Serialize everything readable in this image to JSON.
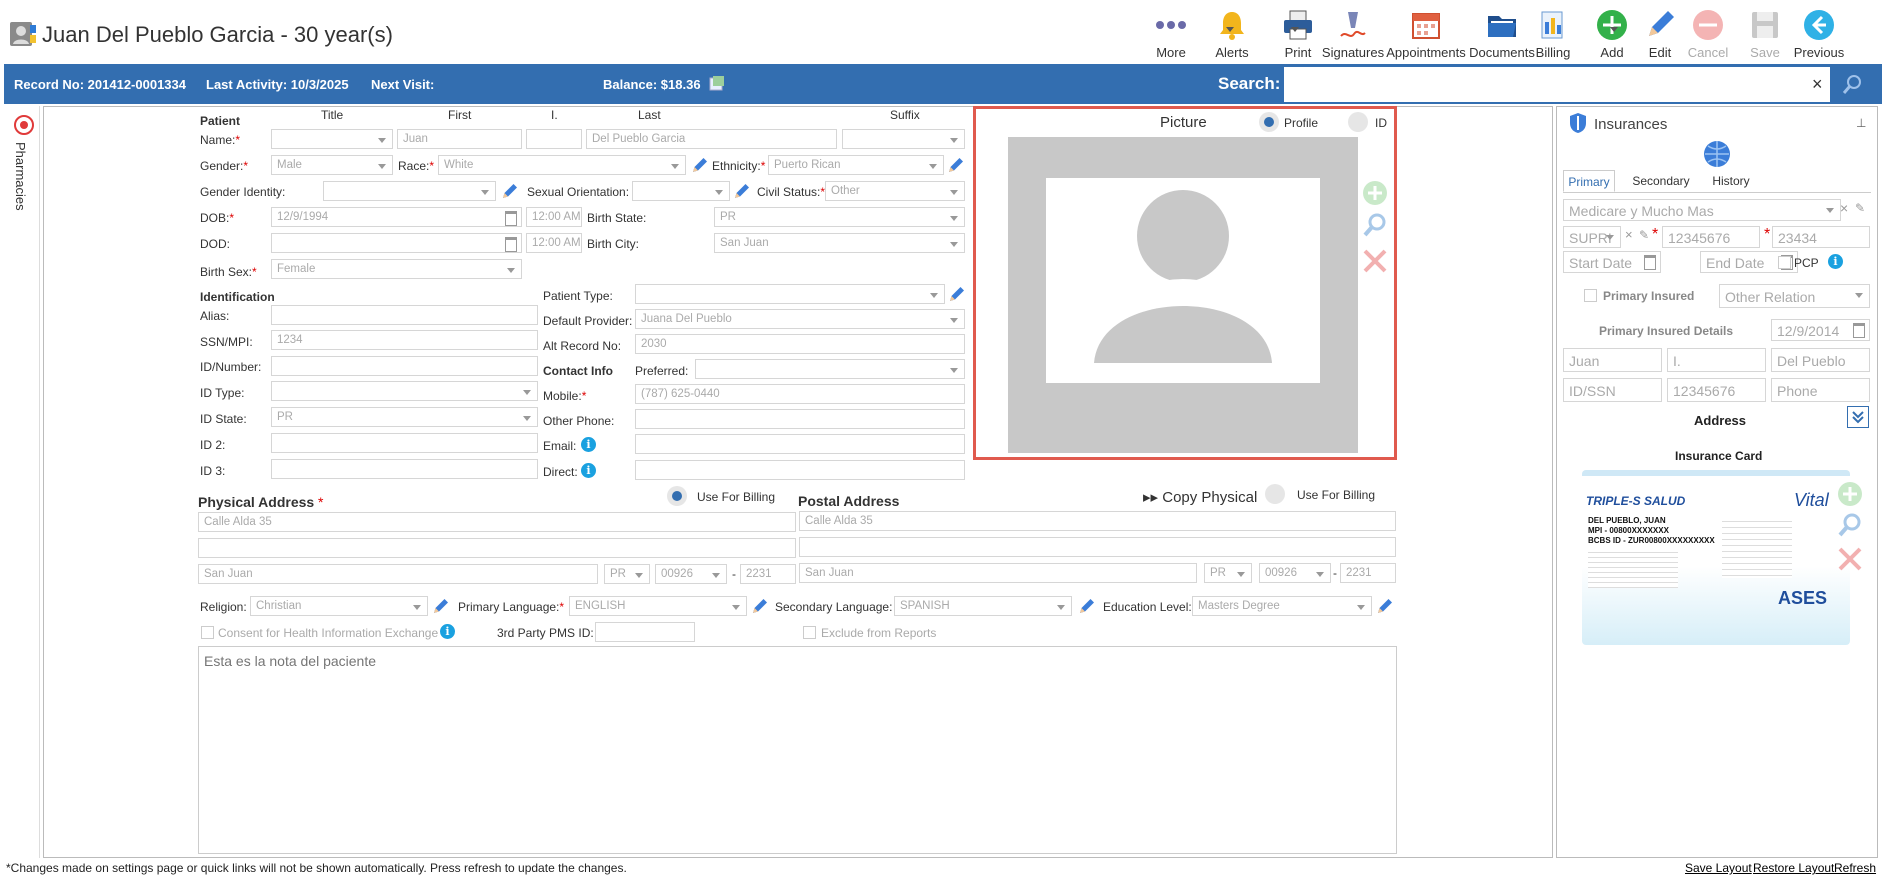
{
  "header": {
    "title": "Juan Del Pueblo Garcia - 30 year(s)",
    "toolbar": [
      {
        "name": "more",
        "label": "More",
        "icon": "more-dots-icon",
        "disabled": false
      },
      {
        "name": "alerts",
        "label": "Alerts",
        "icon": "bell-icon",
        "disabled": false
      },
      {
        "name": "print",
        "label": "Print",
        "icon": "printer-icon",
        "disabled": false
      },
      {
        "name": "signatures",
        "label": "Signatures",
        "icon": "signature-pen-icon",
        "disabled": false
      },
      {
        "name": "appointments",
        "label": "Appointments",
        "icon": "calendar-icon",
        "disabled": false
      },
      {
        "name": "documents",
        "label": "Documents",
        "icon": "folder-icon",
        "disabled": false
      },
      {
        "name": "billing",
        "label": "Billing",
        "icon": "billing-icon",
        "disabled": false
      },
      {
        "name": "add",
        "label": "Add",
        "icon": "plus-circle-icon",
        "disabled": false
      },
      {
        "name": "edit",
        "label": "Edit",
        "icon": "pencil-icon",
        "disabled": false
      },
      {
        "name": "cancel",
        "label": "Cancel",
        "icon": "minus-circle-icon",
        "disabled": true
      },
      {
        "name": "save",
        "label": "Save",
        "icon": "floppy-icon",
        "disabled": true
      },
      {
        "name": "previous",
        "label": "Previous",
        "icon": "back-arrow-icon",
        "disabled": false
      }
    ]
  },
  "infobar": {
    "record": "Record No: 201412-0001334",
    "last_activity": "Last Activity: 10/3/2025",
    "next_visit": "Next Visit:",
    "balance": "Balance: $18.36",
    "search_label": "Search:",
    "search_value": "",
    "clear": "×"
  },
  "sidebar": {
    "pharmacies": "Pharmacies"
  },
  "patient": {
    "section": "Patient",
    "col_title": "Title",
    "col_first": "First",
    "col_i": "I.",
    "col_last": "Last",
    "col_suffix": "Suffix",
    "name_label": "Name:",
    "first": "Juan",
    "middle": "",
    "last": "Del Pueblo Garcia",
    "title": "",
    "suffix": "",
    "gender_label": "Gender:",
    "gender": "Male",
    "race_label": "Race:",
    "race": "White",
    "ethnicity_label": "Ethnicity:",
    "ethnicity": "Puerto Rican",
    "gender_identity_label": "Gender Identity:",
    "gender_identity": "",
    "sexual_orientation_label": "Sexual Orientation:",
    "sexual_orientation": "",
    "civil_status_label": "Civil Status:",
    "civil_status": "Other",
    "dob_label": "DOB:",
    "dob": "12/9/1994",
    "dob_time": "12:00 AM",
    "birth_state_label": "Birth State:",
    "birth_state": "PR",
    "dod_label": "DOD:",
    "dod": "",
    "dod_time": "12:00 AM",
    "birth_city_label": "Birth City:",
    "birth_city": "San Juan",
    "birth_sex_label": "Birth Sex:",
    "birth_sex": "Female",
    "req": "*"
  },
  "identification": {
    "section": "Identification",
    "alias_label": "Alias:",
    "alias": "",
    "ssn_label": "SSN/MPI:",
    "ssn": "1234",
    "idnum_label": "ID/Number:",
    "idnum": "",
    "idtype_label": "ID Type:",
    "idtype": "",
    "idstate_label": "ID State:",
    "idstate": "PR",
    "id2_label": "ID 2:",
    "id2": "",
    "id3_label": "ID 3:",
    "id3": "",
    "patient_type_label": "Patient Type:",
    "patient_type": "",
    "default_provider_label": "Default Provider:",
    "default_provider": "Juana Del Pueblo",
    "alt_record_label": "Alt Record No:",
    "alt_record": "2030"
  },
  "contact": {
    "section": "Contact Info",
    "preferred_label": "Preferred:",
    "preferred": "",
    "mobile_label": "Mobile:",
    "mobile": "(787) 625-0440",
    "other_phone_label": "Other Phone:",
    "other_phone": "",
    "email_label": "Email:",
    "email": "",
    "direct_label": "Direct:",
    "direct": ""
  },
  "picture": {
    "title": "Picture",
    "profile": "Profile",
    "id": "ID"
  },
  "physical": {
    "section": "Physical Address",
    "use_billing": "Use For Billing",
    "line1": "Calle Alda 35",
    "line2": "",
    "city": "San Juan",
    "state": "PR",
    "zip": "00926",
    "zip4": "2231",
    "dash": "-"
  },
  "postal": {
    "section": "Postal Address",
    "copy": "Copy Physical",
    "use_billing": "Use For Billing",
    "line1": "Calle Alda 35",
    "line2": "",
    "city": "San Juan",
    "state": "PR",
    "zip": "00926",
    "zip4": "2231",
    "dash": "-"
  },
  "misc": {
    "religion_label": "Religion:",
    "religion": "Christian",
    "primary_lang_label": "Primary Language:",
    "primary_lang": "ENGLISH",
    "secondary_lang_label": "Secondary Language:",
    "secondary_lang": "SPANISH",
    "education_label": "Education Level:",
    "education": "Masters Degree",
    "consent_label": "Consent for Health Information Exchange",
    "pms_label": "3rd Party PMS ID:",
    "pms": "",
    "exclude_label": "Exclude from Reports",
    "notes_placeholder": "Esta es la nota del paciente"
  },
  "insurance": {
    "title": "Insurances",
    "tabs": [
      "Primary",
      "Secondary",
      "History"
    ],
    "plan": "Medicare y Mucho Mas",
    "relation_code": "SUPRI",
    "policy": "12345676",
    "group": "23434",
    "start_date": "Start Date",
    "end_date": "End Date",
    "pcp": "PCP",
    "primary_insured": "Primary Insured",
    "other_relation": "Other Relation",
    "insured_details": "Primary Insured Details",
    "insured_dob": "12/9/2014",
    "insured_first": "Juan",
    "insured_mi": "I.",
    "insured_last": "Del Pueblo",
    "insured_idssn": "ID/SSN",
    "insured_id": "12345676",
    "insured_phone": "Phone",
    "address": "Address",
    "card_title": "Insurance Card",
    "card": {
      "brand": "TRIPLE-S SALUD",
      "vital": "Vital",
      "name": "DEL PUEBLO, JUAN",
      "mpi": "MPI - 00800XXXXXXX",
      "bcbs": "BCBS ID - ZUR00800XXXXXXXXX",
      "ases": "ASES"
    }
  },
  "footer": {
    "note": "*Changes made on settings page or quick links will not be shown automatically. Press refresh to update the changes.",
    "save_layout": "Save Layout",
    "restore_layout": "Restore Layout",
    "refresh": "Refresh"
  },
  "colors": {
    "brand_blue": "#336eb0",
    "picture_border": "#e05a4e",
    "required": "#dd0000",
    "info": "#1aa1e0"
  }
}
